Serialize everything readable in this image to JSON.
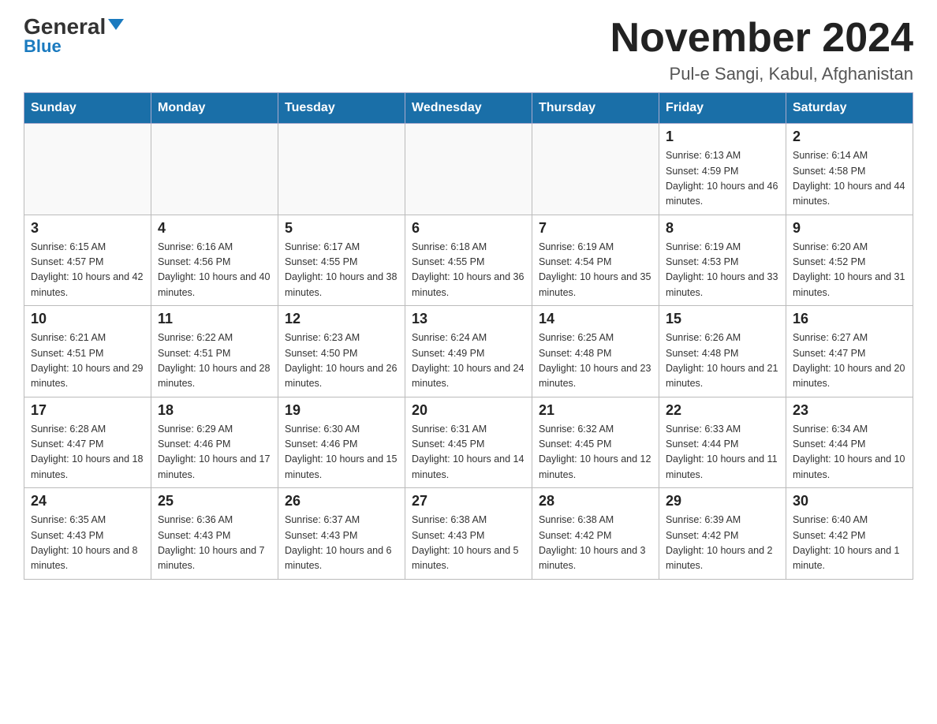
{
  "header": {
    "logo_general": "General",
    "logo_blue": "Blue",
    "title": "November 2024",
    "subtitle": "Pul-e Sangi, Kabul, Afghanistan"
  },
  "days_of_week": [
    "Sunday",
    "Monday",
    "Tuesday",
    "Wednesday",
    "Thursday",
    "Friday",
    "Saturday"
  ],
  "weeks": [
    [
      {
        "day": "",
        "info": ""
      },
      {
        "day": "",
        "info": ""
      },
      {
        "day": "",
        "info": ""
      },
      {
        "day": "",
        "info": ""
      },
      {
        "day": "",
        "info": ""
      },
      {
        "day": "1",
        "info": "Sunrise: 6:13 AM\nSunset: 4:59 PM\nDaylight: 10 hours and 46 minutes."
      },
      {
        "day": "2",
        "info": "Sunrise: 6:14 AM\nSunset: 4:58 PM\nDaylight: 10 hours and 44 minutes."
      }
    ],
    [
      {
        "day": "3",
        "info": "Sunrise: 6:15 AM\nSunset: 4:57 PM\nDaylight: 10 hours and 42 minutes."
      },
      {
        "day": "4",
        "info": "Sunrise: 6:16 AM\nSunset: 4:56 PM\nDaylight: 10 hours and 40 minutes."
      },
      {
        "day": "5",
        "info": "Sunrise: 6:17 AM\nSunset: 4:55 PM\nDaylight: 10 hours and 38 minutes."
      },
      {
        "day": "6",
        "info": "Sunrise: 6:18 AM\nSunset: 4:55 PM\nDaylight: 10 hours and 36 minutes."
      },
      {
        "day": "7",
        "info": "Sunrise: 6:19 AM\nSunset: 4:54 PM\nDaylight: 10 hours and 35 minutes."
      },
      {
        "day": "8",
        "info": "Sunrise: 6:19 AM\nSunset: 4:53 PM\nDaylight: 10 hours and 33 minutes."
      },
      {
        "day": "9",
        "info": "Sunrise: 6:20 AM\nSunset: 4:52 PM\nDaylight: 10 hours and 31 minutes."
      }
    ],
    [
      {
        "day": "10",
        "info": "Sunrise: 6:21 AM\nSunset: 4:51 PM\nDaylight: 10 hours and 29 minutes."
      },
      {
        "day": "11",
        "info": "Sunrise: 6:22 AM\nSunset: 4:51 PM\nDaylight: 10 hours and 28 minutes."
      },
      {
        "day": "12",
        "info": "Sunrise: 6:23 AM\nSunset: 4:50 PM\nDaylight: 10 hours and 26 minutes."
      },
      {
        "day": "13",
        "info": "Sunrise: 6:24 AM\nSunset: 4:49 PM\nDaylight: 10 hours and 24 minutes."
      },
      {
        "day": "14",
        "info": "Sunrise: 6:25 AM\nSunset: 4:48 PM\nDaylight: 10 hours and 23 minutes."
      },
      {
        "day": "15",
        "info": "Sunrise: 6:26 AM\nSunset: 4:48 PM\nDaylight: 10 hours and 21 minutes."
      },
      {
        "day": "16",
        "info": "Sunrise: 6:27 AM\nSunset: 4:47 PM\nDaylight: 10 hours and 20 minutes."
      }
    ],
    [
      {
        "day": "17",
        "info": "Sunrise: 6:28 AM\nSunset: 4:47 PM\nDaylight: 10 hours and 18 minutes."
      },
      {
        "day": "18",
        "info": "Sunrise: 6:29 AM\nSunset: 4:46 PM\nDaylight: 10 hours and 17 minutes."
      },
      {
        "day": "19",
        "info": "Sunrise: 6:30 AM\nSunset: 4:46 PM\nDaylight: 10 hours and 15 minutes."
      },
      {
        "day": "20",
        "info": "Sunrise: 6:31 AM\nSunset: 4:45 PM\nDaylight: 10 hours and 14 minutes."
      },
      {
        "day": "21",
        "info": "Sunrise: 6:32 AM\nSunset: 4:45 PM\nDaylight: 10 hours and 12 minutes."
      },
      {
        "day": "22",
        "info": "Sunrise: 6:33 AM\nSunset: 4:44 PM\nDaylight: 10 hours and 11 minutes."
      },
      {
        "day": "23",
        "info": "Sunrise: 6:34 AM\nSunset: 4:44 PM\nDaylight: 10 hours and 10 minutes."
      }
    ],
    [
      {
        "day": "24",
        "info": "Sunrise: 6:35 AM\nSunset: 4:43 PM\nDaylight: 10 hours and 8 minutes."
      },
      {
        "day": "25",
        "info": "Sunrise: 6:36 AM\nSunset: 4:43 PM\nDaylight: 10 hours and 7 minutes."
      },
      {
        "day": "26",
        "info": "Sunrise: 6:37 AM\nSunset: 4:43 PM\nDaylight: 10 hours and 6 minutes."
      },
      {
        "day": "27",
        "info": "Sunrise: 6:38 AM\nSunset: 4:43 PM\nDaylight: 10 hours and 5 minutes."
      },
      {
        "day": "28",
        "info": "Sunrise: 6:38 AM\nSunset: 4:42 PM\nDaylight: 10 hours and 3 minutes."
      },
      {
        "day": "29",
        "info": "Sunrise: 6:39 AM\nSunset: 4:42 PM\nDaylight: 10 hours and 2 minutes."
      },
      {
        "day": "30",
        "info": "Sunrise: 6:40 AM\nSunset: 4:42 PM\nDaylight: 10 hours and 1 minute."
      }
    ]
  ]
}
